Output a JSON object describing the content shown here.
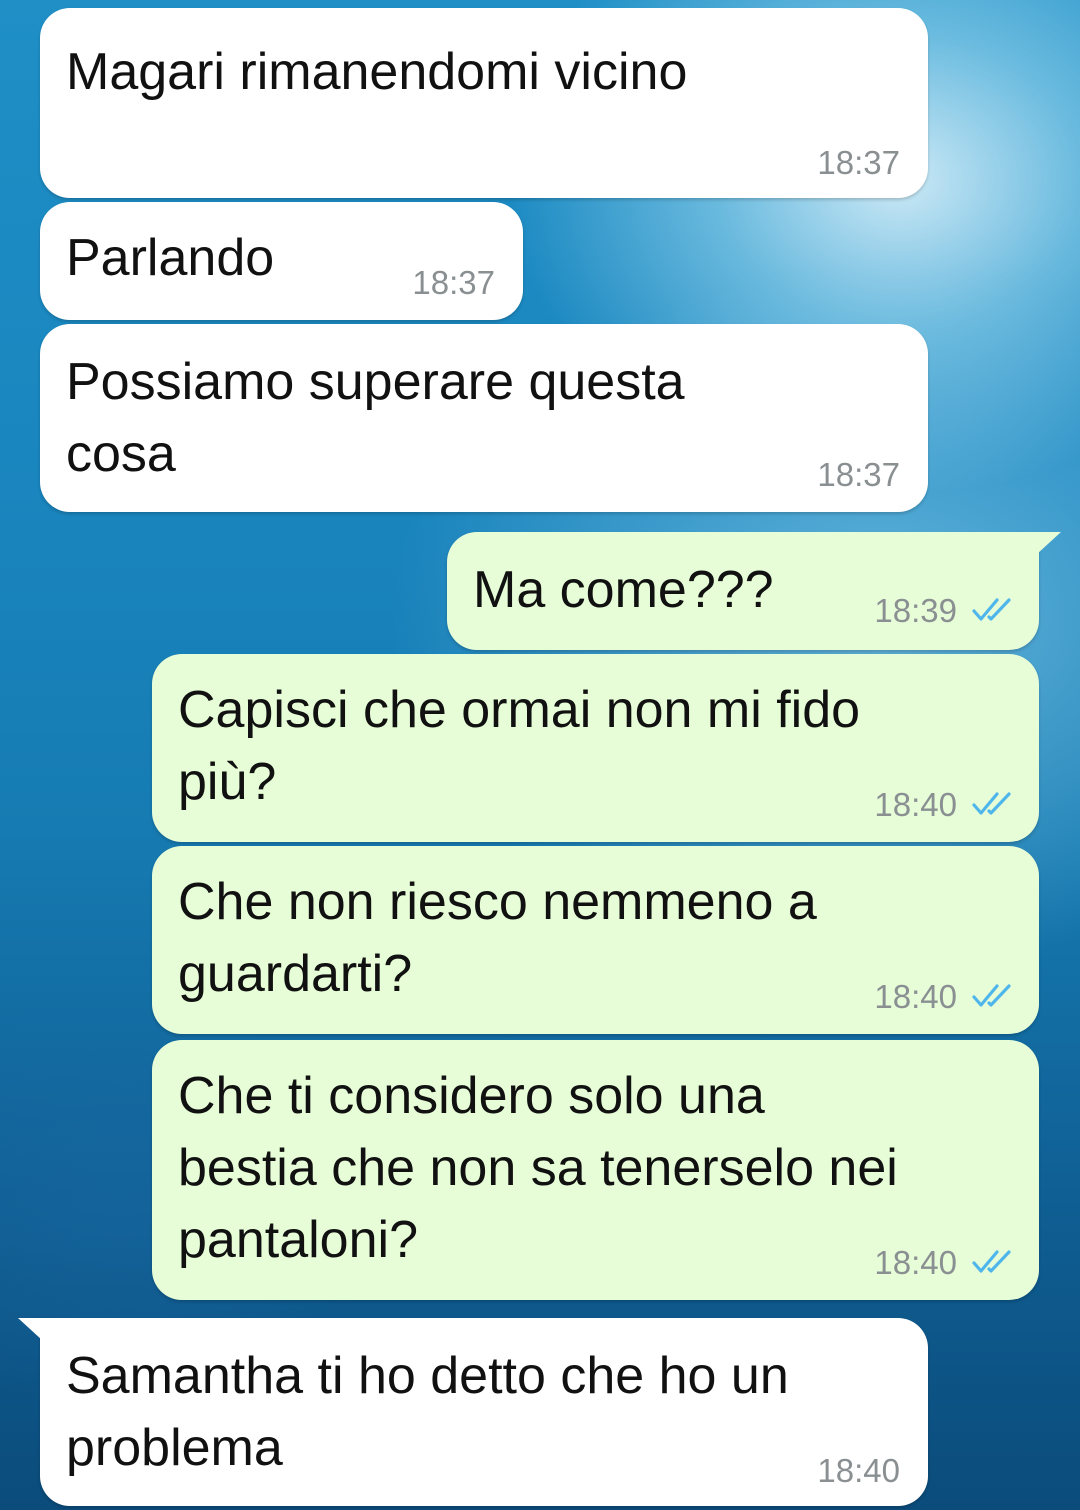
{
  "messages": [
    {
      "direction": "in",
      "text": "Magari rimanendomi vicino",
      "time": "18:37"
    },
    {
      "direction": "in",
      "text": "Parlando",
      "time": "18:37"
    },
    {
      "direction": "in",
      "text": "Possiamo superare questa\ncosa",
      "time": "18:37"
    },
    {
      "direction": "out",
      "text": "Ma come???",
      "time": "18:39",
      "status": "read-double-check-icon"
    },
    {
      "direction": "out",
      "text": "Capisci che ormai non mi fido\npiù?",
      "time": "18:40",
      "status": "read-double-check-icon"
    },
    {
      "direction": "out",
      "text": "Che non riesco nemmeno a\nguardarti?",
      "time": "18:40",
      "status": "read-double-check-icon"
    },
    {
      "direction": "out",
      "text": "Che ti considero solo una\nbestia che non sa tenerselo nei\npantaloni?",
      "time": "18:40",
      "status": "read-double-check-icon"
    },
    {
      "direction": "in",
      "text": "Samantha ti ho detto che ho un\nproblema",
      "time": "18:40"
    }
  ],
  "colors": {
    "incoming_bubble": "#ffffff",
    "outgoing_bubble": "#e7fdd7",
    "read_ticks": "#4fb6ec",
    "timestamp": "#8a8f92"
  }
}
